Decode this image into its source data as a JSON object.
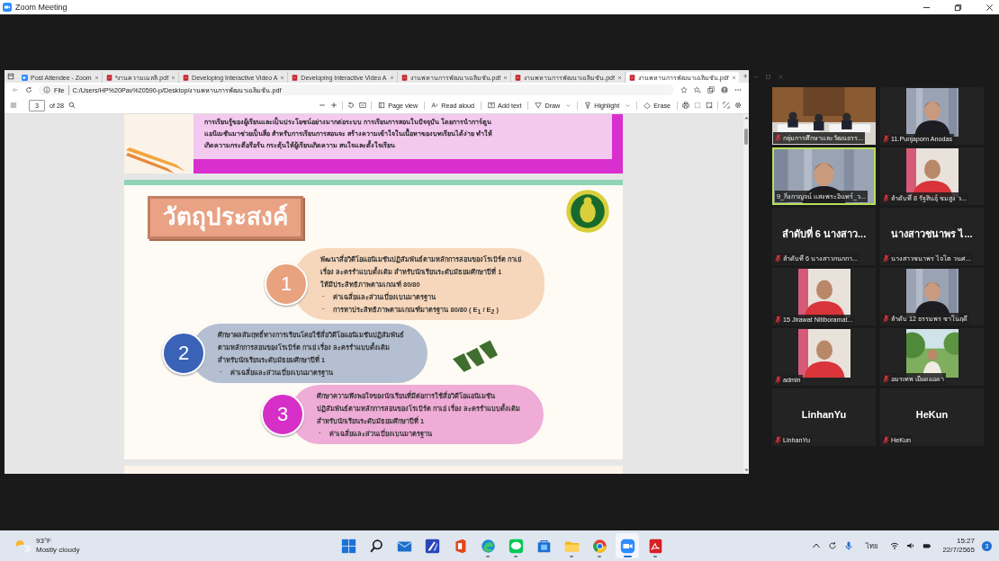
{
  "zoom_window": {
    "title": "Zoom Meeting"
  },
  "browser": {
    "tabs": [
      {
        "kind": "zoom",
        "title": "Post Attendee - Zoom",
        "selected": false
      },
      {
        "kind": "pdf",
        "title": "*งานความเมลลิ.pdf",
        "selected": false
      },
      {
        "kind": "pdf",
        "title": "Developing Interactive Video A",
        "selected": false
      },
      {
        "kind": "pdf",
        "title": "Developing Interactive Video A",
        "selected": false
      },
      {
        "kind": "pdf",
        "title": "งานพหานการพัฒนาเฉลิมชัน.pdf",
        "selected": false
      },
      {
        "kind": "pdf",
        "title": "งานพหานการพัฒนาเฉลิมชัน.pdf",
        "selected": false
      },
      {
        "kind": "pdf",
        "title": "งานพหานการพัฒนาเฉลิมชัน.pdf",
        "selected": true
      }
    ],
    "new_tab": "+",
    "address": {
      "scheme": "File",
      "url": "C:/Users/HP%20Pav%20590-p/Desktop/งานพหานการพัฒนาเฉลิมชัน.pdf"
    },
    "pdf_toolbar": {
      "page": "3",
      "page_count": "of 28",
      "tools": [
        {
          "kind": "view",
          "label": "Page view",
          "menu": false
        },
        {
          "kind": "read",
          "label": "Read aloud",
          "menu": false
        },
        {
          "kind": "text",
          "label": "Add text",
          "menu": false
        },
        {
          "kind": "draw",
          "label": "Draw",
          "menu": true
        },
        {
          "kind": "highlight",
          "label": "Highlight",
          "menu": true
        },
        {
          "kind": "erase",
          "label": "Erase",
          "menu": false
        }
      ]
    },
    "document": {
      "intro_lines": [
        "การเรียนรู้ของผู้เรียนและเป็นประโยชน์อย่างมากต่อระบบ การเรียนการสอนในปัจจุบัน โดยการนำการ์ตูน",
        "แอนิเมชันมาช่วยเป็นสื่อ สำหรับการเรียนการสอนจะ สร้างความเข้าใจในเนื้อหาของบทเรียนได้ง่าย ทำให้",
        "เกิดความกระตือรือร้น กระตุ้นให้ผู้เรียนเกิดความ สนใจและตั้งใจเรียน"
      ],
      "title": "วัตถุประสงค์",
      "objectives": [
        {
          "number": "1",
          "color": "#e9a27e",
          "lines": [
            "พัฒนาสื่อวิดีโอแอนิเมชันปฏิสัมพันธ์ตามหลักการสอนของโรเบิร์ต กาเย่",
            "เรื่อง ละครรำแบบดั้งเดิม สำหรับนักเรียนระดับมัธยมศึกษาปีที่ 1",
            "ให้มีประสิทธิภาพตามเกณฑ์ 80/80"
          ],
          "bullets": [
            {
              "marker": "-",
              "text": "ค่าเฉลี่ยและส่วนเบี่ยงเบนมาตรฐาน"
            },
            {
              "marker": "-",
              "text": "การหาประสิทธิภาพตามเกณฑ์มาตรฐาน 80/80 ( E$_{1}$ / E$_{2}$ )"
            }
          ]
        },
        {
          "number": "2",
          "color": "#3a63b8",
          "lines": [
            "ศึกษาผลสัมฤทธิ์ทางการเรียนโดยใช้สื่อวิดีโอแอนิเมชันปฏิสัมพันธ์",
            "ตามหลักการสอนของโรเบิร์ต กาเย่ เรื่อง ละครรำแบบดั้งเดิม",
            "สำหรับนักเรียนระดับมัธยมศึกษาปีที่ 1"
          ],
          "bullets": [
            {
              "marker": "-",
              "text": "ค่าเฉลี่ยและส่วนเบี่ยงเบนมาตรฐาน"
            }
          ]
        },
        {
          "number": "3",
          "color": "#d62fc8",
          "lines": [
            "ศึกษาความพึงพอใจของนักเรียนที่มีต่อการใช้สื่อวิดีโอแอนิเมชัน",
            "ปฏิสัมพันธ์ตามหลักการสอนของโรเบิร์ต กาเย่ เรื่อง ละครรำแบบดั้งเดิม",
            "สำหรับนักเรียนระดับมัธยมศึกษาปีที่ 1"
          ],
          "bullets": [
            {
              "marker": "-",
              "text": "ค่าเฉลี่ยและส่วนเบี่ยงเบนมาตรฐาน"
            }
          ]
        }
      ]
    }
  },
  "gallery": [
    {
      "kind": "video",
      "name": "กลุ่มการศึกษาและวัฒนธรร...",
      "muted": true,
      "speaking": false
    },
    {
      "name": "11.Punjaporn  Anodas",
      "muted": true,
      "speaking": false
    },
    {
      "kind": "video",
      "name": "9_กิ่งกาญจน์ แสงพระอินทร์_ว...",
      "muted": false,
      "speaking": true
    },
    {
      "name": "ลำดับที่ 8 รัฐสินธุ์ ชมสูง ว...",
      "muted": true,
      "speaking": false
    },
    {
      "kind": "name",
      "display": "ลำดับที่ 6 นางสาว...",
      "name": "ลำดับที่ 6 นางสาวกนกกา...",
      "muted": true,
      "speaking": false
    },
    {
      "kind": "name",
      "display": "นางสาวชนาพร ไ...",
      "name": "นางสาวชนาพร ไจโต วนศ...",
      "muted": true,
      "speaking": false
    },
    {
      "name": "15 Jirawat Nitiboramat...",
      "muted": true,
      "speaking": false
    },
    {
      "name": "ลำดับ 12 ธรรมพร ชาโนฤดี",
      "muted": true,
      "speaking": false
    },
    {
      "name": "admin",
      "muted": true,
      "speaking": false
    },
    {
      "name": "อมรเทพ เยียดยอดา",
      "muted": true,
      "speaking": false
    },
    {
      "kind": "name",
      "display": "LinhanYu",
      "name": "LinhanYu",
      "muted": true,
      "speaking": false
    },
    {
      "kind": "name",
      "display": "HeKun",
      "name": "HeKun",
      "muted": true,
      "speaking": false
    }
  ],
  "taskbar": {
    "weather": {
      "temperature": "93°F",
      "condition": "Mostly cloudy"
    },
    "apps": [
      {
        "kind": "start",
        "running": false,
        "selected": false
      },
      {
        "kind": "search",
        "running": false,
        "selected": false
      },
      {
        "kind": "mail",
        "running": false,
        "selected": false
      },
      {
        "kind": "editor",
        "running": false,
        "selected": false
      },
      {
        "kind": "office",
        "running": false,
        "selected": false
      },
      {
        "kind": "edge",
        "running": true,
        "selected": false
      },
      {
        "kind": "line",
        "running": true,
        "selected": false
      },
      {
        "kind": "store",
        "running": false,
        "selected": false
      },
      {
        "kind": "folder",
        "running": true,
        "selected": false
      },
      {
        "kind": "chrome",
        "running": true,
        "selected": false
      },
      {
        "kind": "zoom",
        "running": true,
        "selected": true
      },
      {
        "kind": "acrobat",
        "running": true,
        "selected": false
      }
    ],
    "language": "ไทย",
    "time": "15:27",
    "date": "22/7/2565",
    "notifications": "3"
  }
}
